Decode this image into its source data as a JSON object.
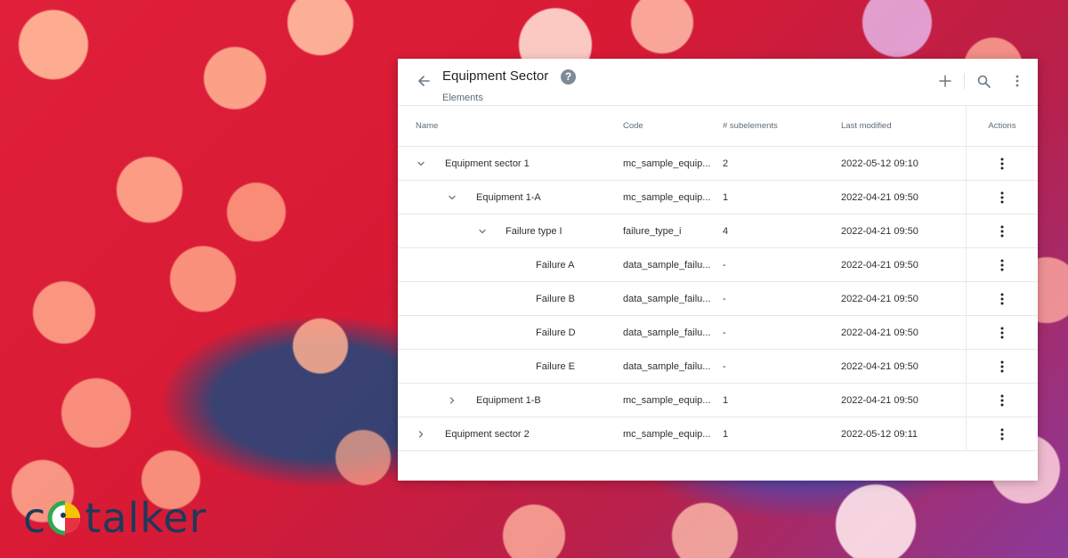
{
  "header": {
    "title": "Equipment Sector",
    "subtitle": "Elements"
  },
  "columns": {
    "name": "Name",
    "code": "Code",
    "subelements": "# subelements",
    "last_modified": "Last modified",
    "actions": "Actions"
  },
  "rows": [
    {
      "name": "Equipment sector 1",
      "code": "mc_sample_equip...",
      "subelements": "2",
      "modified": "2022-05-12 09:10",
      "level": 0,
      "toggle": "expanded"
    },
    {
      "name": "Equipment 1-A",
      "code": "mc_sample_equip...",
      "subelements": "1",
      "modified": "2022-04-21 09:50",
      "level": 1,
      "toggle": "expanded"
    },
    {
      "name": "Failure type I",
      "code": "failure_type_i",
      "subelements": "4",
      "modified": "2022-04-21 09:50",
      "level": 2,
      "toggle": "expanded"
    },
    {
      "name": "Failure A",
      "code": "data_sample_failu...",
      "subelements": "-",
      "modified": "2022-04-21 09:50",
      "level": 3,
      "toggle": "none"
    },
    {
      "name": "Failure B",
      "code": "data_sample_failu...",
      "subelements": "-",
      "modified": "2022-04-21 09:50",
      "level": 3,
      "toggle": "none"
    },
    {
      "name": "Failure D",
      "code": "data_sample_failu...",
      "subelements": "-",
      "modified": "2022-04-21 09:50",
      "level": 3,
      "toggle": "none"
    },
    {
      "name": "Failure E",
      "code": "data_sample_failu...",
      "subelements": "-",
      "modified": "2022-04-21 09:50",
      "level": 3,
      "toggle": "none"
    },
    {
      "name": "Equipment 1-B",
      "code": "mc_sample_equip...",
      "subelements": "1",
      "modified": "2022-04-21 09:50",
      "level": 1,
      "toggle": "collapsed"
    },
    {
      "name": "Equipment sector 2",
      "code": "mc_sample_equip...",
      "subelements": "1",
      "modified": "2022-05-12 09:11",
      "level": 0,
      "toggle": "collapsed"
    }
  ],
  "logo": {
    "text_start": "c",
    "text_end": "talker"
  },
  "icons": {
    "back": "arrow-left-icon",
    "help": "help-circle-icon",
    "add": "plus-icon",
    "search": "search-icon",
    "more": "more-vertical-icon",
    "expanded": "chevron-down-icon",
    "collapsed": "chevron-right-icon"
  },
  "colors": {
    "logo_text": "#1d3a5a",
    "icon_gray": "#7d8a96",
    "logo_green": "#2fa84f",
    "logo_yellow": "#f4c400",
    "logo_red": "#e5333f"
  }
}
